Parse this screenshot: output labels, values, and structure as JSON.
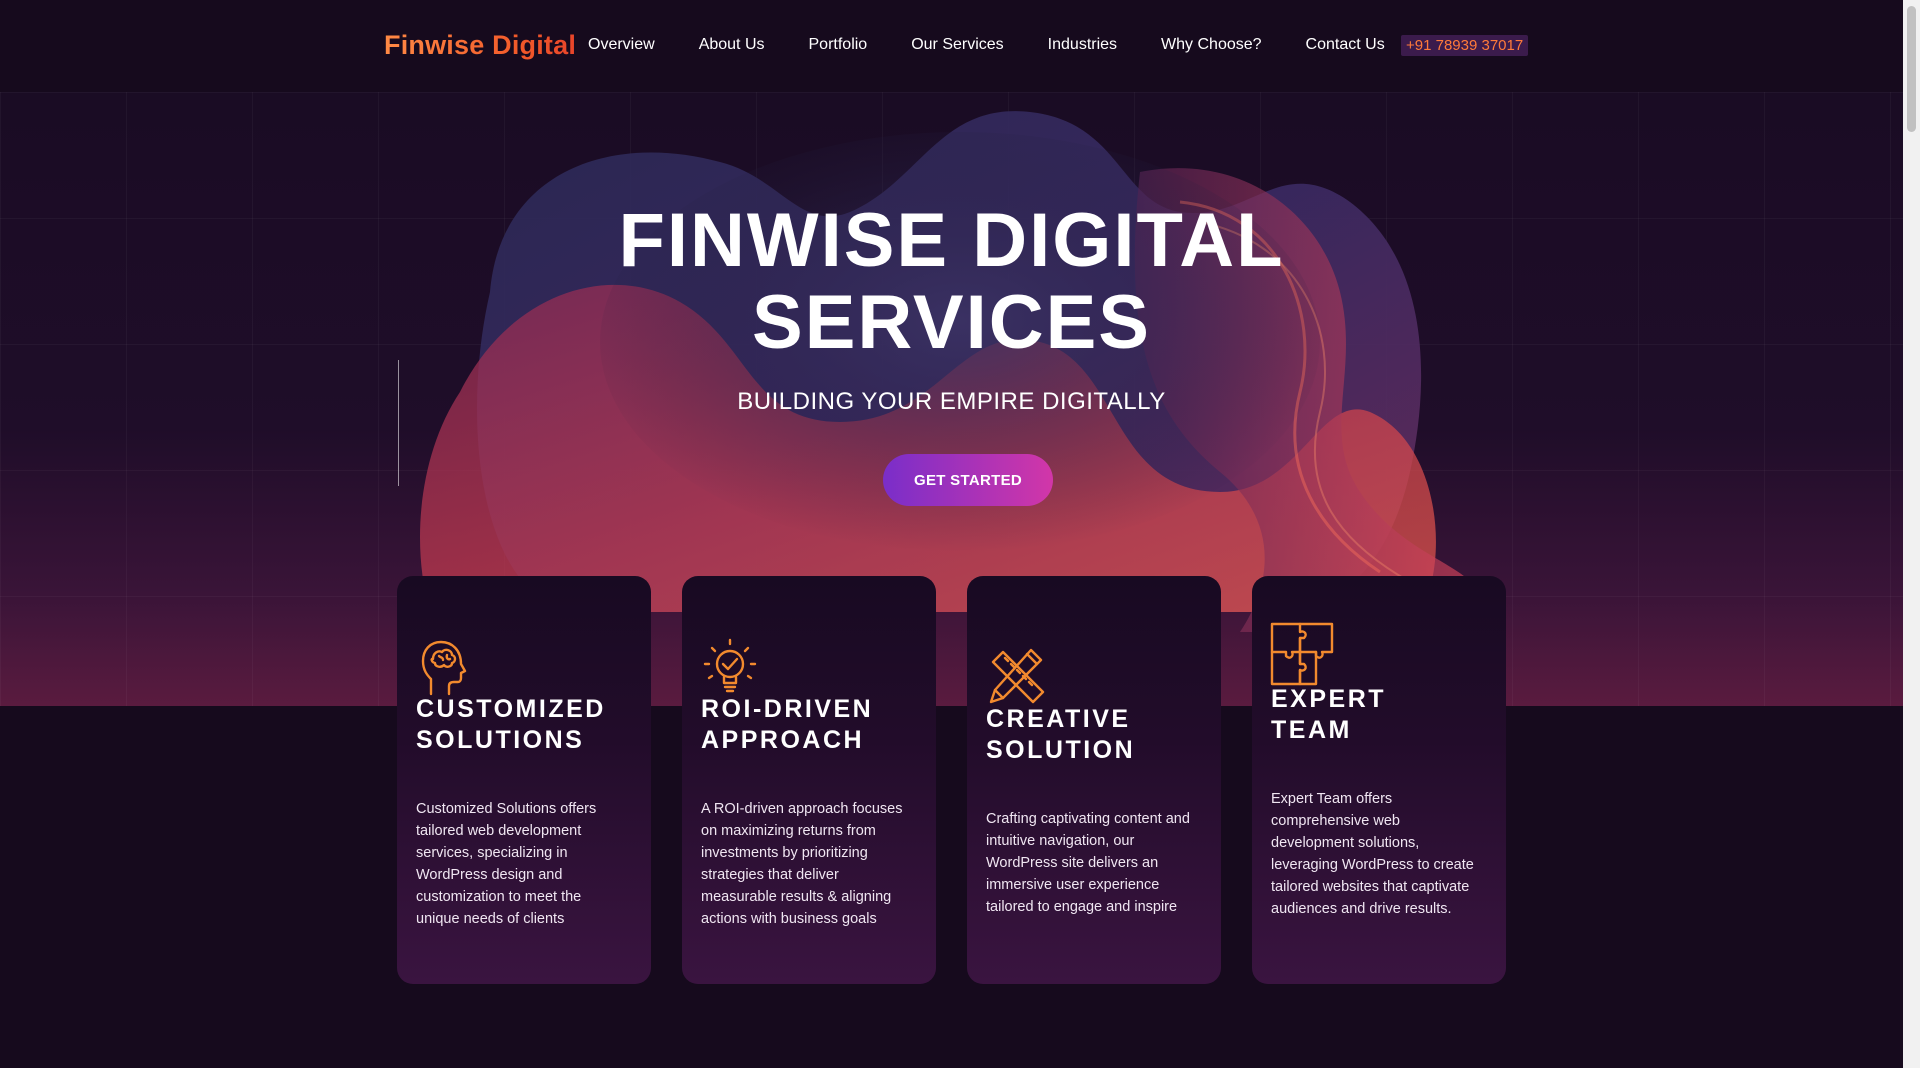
{
  "brand": {
    "name": "Finwise Digital"
  },
  "nav": {
    "items": [
      {
        "label": "Overview"
      },
      {
        "label": "About Us"
      },
      {
        "label": "Portfolio"
      },
      {
        "label": "Our Services"
      },
      {
        "label": "Industries"
      },
      {
        "label": "Why Choose?"
      },
      {
        "label": "Contact Us"
      }
    ],
    "phone": "+91 78939 37017"
  },
  "hero": {
    "title_line1": "FINWISE DIGITAL",
    "title_line2": "SERVICES",
    "subtitle": "BUILDING YOUR EMPIRE DIGITALLY",
    "cta_label": "GET STARTED"
  },
  "cards": [
    {
      "icon": "brain-head-icon",
      "title_line1": "CUSTOMIZED",
      "title_line2": "SOLUTIONS",
      "text": "Customized Solutions offers tailored web development services, specializing in WordPress design and customization to meet the unique needs of clients"
    },
    {
      "icon": "lightbulb-check-icon",
      "title_line1": "ROI-DRIVEN",
      "title_line2": "APPROACH",
      "text": "A ROI-driven approach focuses on maximizing returns from investments by prioritizing strategies that deliver measurable results & aligning actions with business goals"
    },
    {
      "icon": "pencil-ruler-icon",
      "title_line1": "CREATIVE",
      "title_line2": "SOLUTION",
      "text": "Crafting captivating content and intuitive navigation, our WordPress site delivers an immersive user experience tailored to engage and inspire"
    },
    {
      "icon": "puzzle-icon",
      "title_line1": "EXPERT",
      "title_line2": "TEAM",
      "text": "Expert Team offers comprehensive web development solutions, leveraging WordPress to create tailored websites that captivate audiences and drive results."
    }
  ],
  "colors": {
    "accent_orange": "#f28a2e",
    "cta_start": "#7a2ec9",
    "cta_end": "#d236a8",
    "background": "#160a1d"
  }
}
